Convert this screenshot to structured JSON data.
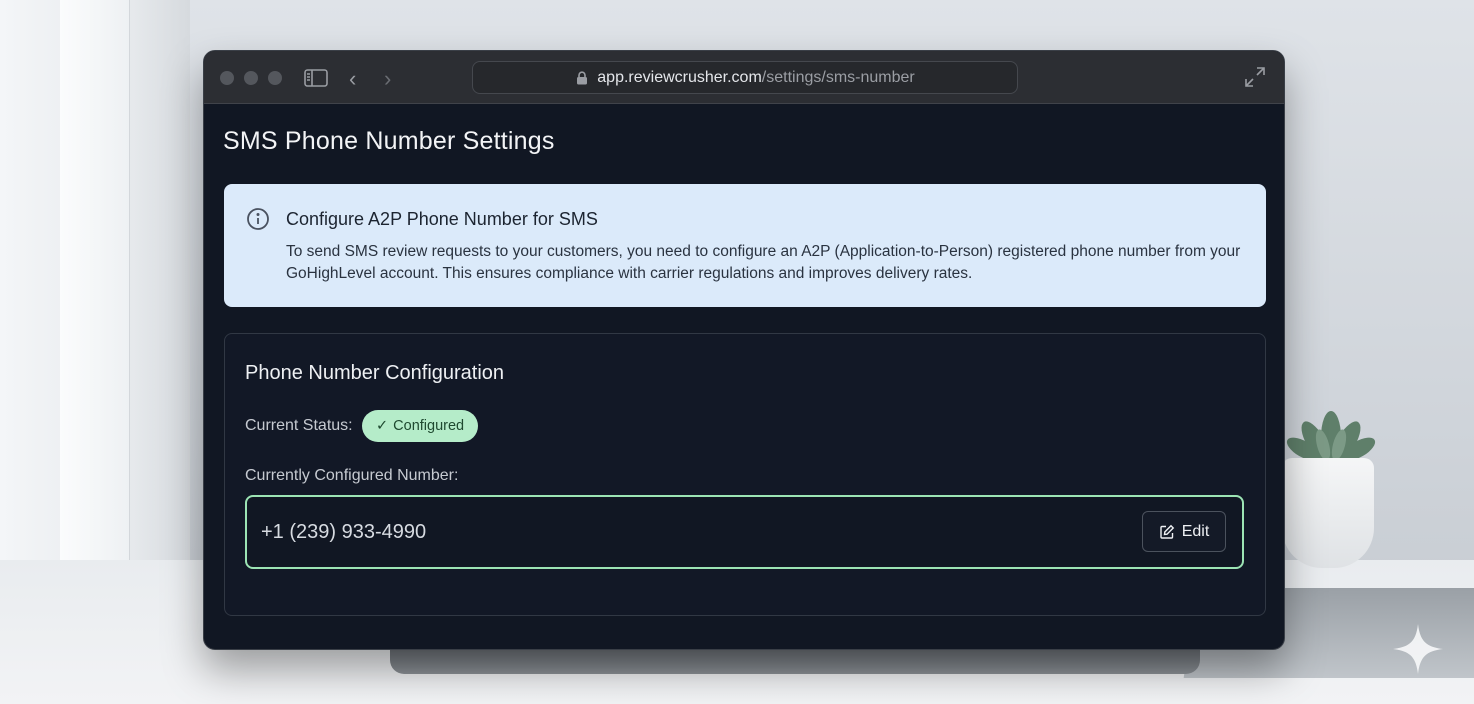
{
  "browser": {
    "url_domain": "app.reviewcrusher.com",
    "url_path": "/settings/sms-number",
    "icons": [
      "sidebar-toggle-icon",
      "chevron-left-icon",
      "chevron-right-icon",
      "lock-icon",
      "expand-icon"
    ]
  },
  "page": {
    "title": "SMS Phone Number Settings"
  },
  "info": {
    "title": "Configure A2P Phone Number for SMS",
    "text": "To send SMS review requests to your customers, you need to configure an A2P (Application-to-Person) registered phone number from your GoHighLevel account. This ensures compliance with carrier regulations and improves delivery rates.",
    "icon": "info-icon"
  },
  "config": {
    "title": "Phone Number Configuration",
    "status_label": "Current Status:",
    "status_check": "✓",
    "status_value": "Configured",
    "number_label": "Currently Configured Number:",
    "number_value": "+1 (239) 933-4990",
    "edit_label": "Edit"
  },
  "colors": {
    "page_bg": "#111723",
    "info_bg": "#dbeafa",
    "badge_bg": "#b5ecc9",
    "field_border": "#9ce4b4"
  }
}
